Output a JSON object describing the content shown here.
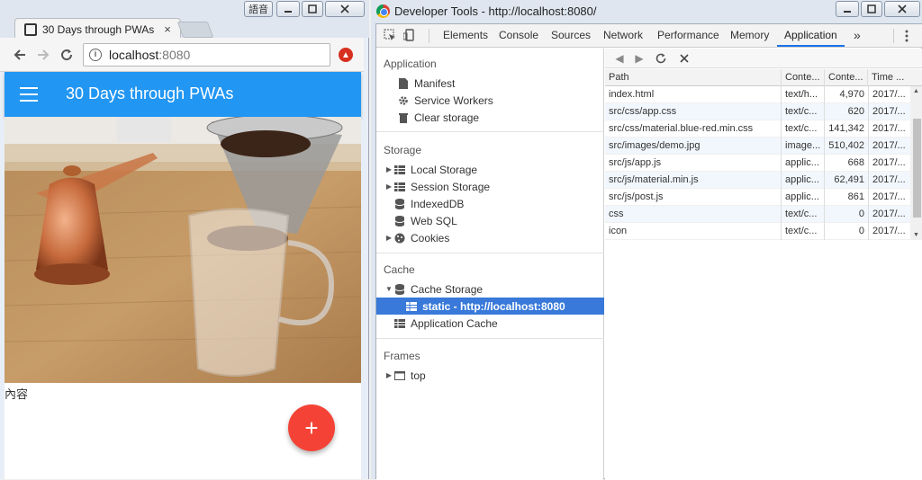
{
  "browser": {
    "tab_title": "30 Days through PWAs",
    "tab_close": "×",
    "ime_button": "語音",
    "url_host": "localhost",
    "url_port": ":8080",
    "page": {
      "appbar_title": "30 Days through PWAs",
      "caption": "內容",
      "fab_label": "+",
      "colors": {
        "appbar": "#2196f3",
        "fab": "#f44336"
      }
    }
  },
  "devtools": {
    "window_title": "Developer Tools - http://localhost:8080/",
    "tabs": [
      "Elements",
      "Console",
      "Sources",
      "Network",
      "Performance",
      "Memory",
      "Application"
    ],
    "active_tab": "Application",
    "more_tabs": "»",
    "sidebar": {
      "application_title": "Application",
      "application_items": [
        "Manifest",
        "Service Workers",
        "Clear storage"
      ],
      "storage_title": "Storage",
      "storage_items": [
        "Local Storage",
        "Session Storage",
        "IndexedDB",
        "Web SQL",
        "Cookies"
      ],
      "cache_title": "Cache",
      "cache_items": [
        "Cache Storage",
        "static - http://localhost:8080",
        "Application Cache"
      ],
      "frames_title": "Frames",
      "frames_items": [
        "top"
      ]
    },
    "table": {
      "headers": [
        "Path",
        "Conte...",
        "Conte...",
        "Time ..."
      ],
      "rows": [
        [
          "index.html",
          "text/h...",
          "4,970",
          "2017/..."
        ],
        [
          "src/css/app.css",
          "text/c...",
          "620",
          "2017/..."
        ],
        [
          "src/css/material.blue-red.min.css",
          "text/c...",
          "141,342",
          "2017/..."
        ],
        [
          "src/images/demo.jpg",
          "image...",
          "510,402",
          "2017/..."
        ],
        [
          "src/js/app.js",
          "applic...",
          "668",
          "2017/..."
        ],
        [
          "src/js/material.min.js",
          "applic...",
          "62,491",
          "2017/..."
        ],
        [
          "src/js/post.js",
          "applic...",
          "861",
          "2017/..."
        ],
        [
          "css",
          "text/c...",
          "0",
          "2017/..."
        ],
        [
          "icon",
          "text/c...",
          "0",
          "2017/..."
        ]
      ]
    }
  }
}
